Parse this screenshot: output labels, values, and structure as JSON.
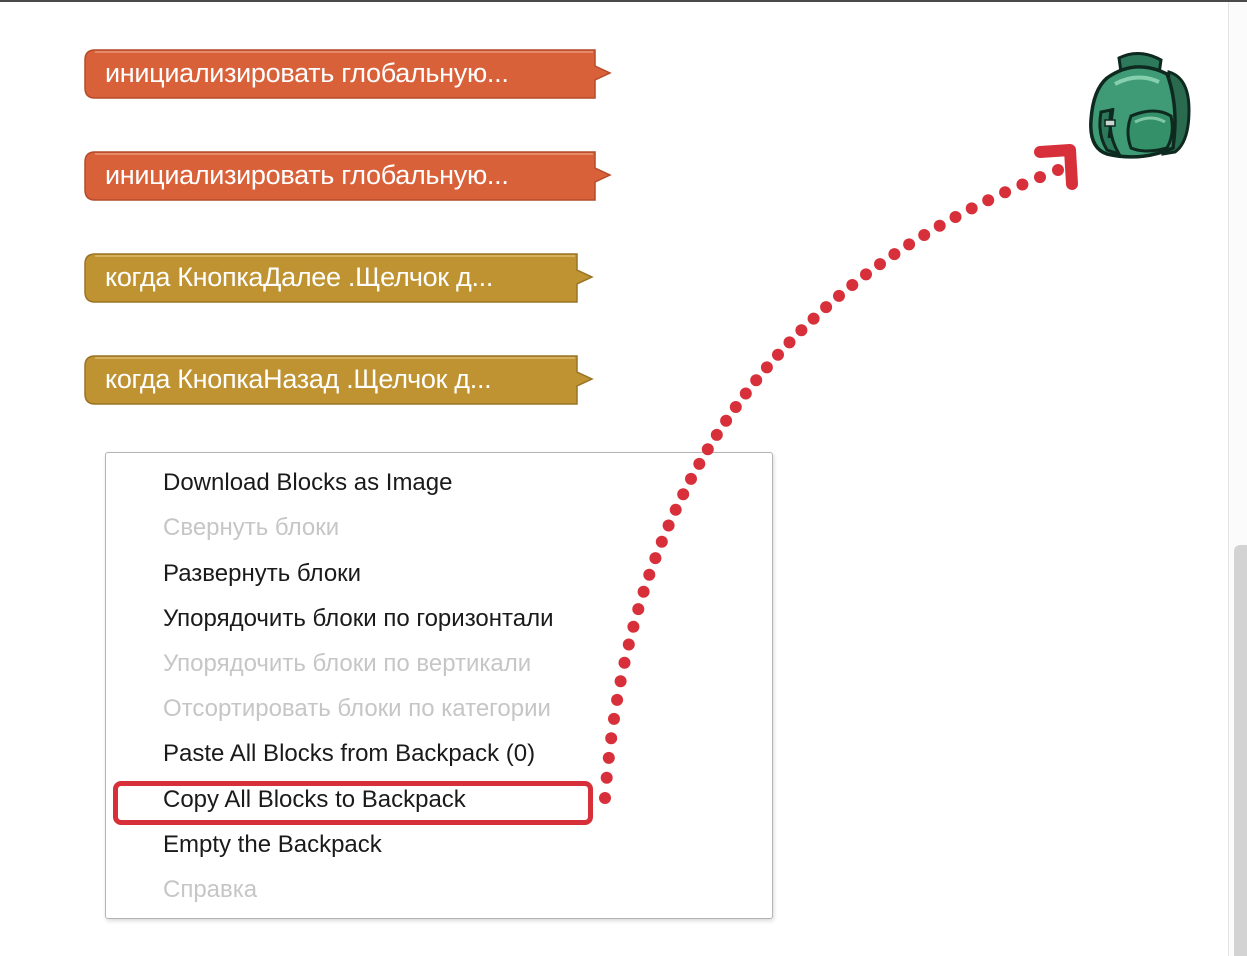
{
  "workspace": {
    "blocks": [
      {
        "label": "инициализировать глобальную...",
        "color": "#d9613a",
        "kind": "variable"
      },
      {
        "label": "инициализировать глобальную...",
        "color": "#d9613a",
        "kind": "variable"
      },
      {
        "label": "когда КнопкаДалее .Щелчок д...",
        "color": "#bf9331",
        "kind": "event"
      },
      {
        "label": "когда КнопкаНазад .Щелчок д...",
        "color": "#bf9331",
        "kind": "event"
      }
    ],
    "backpack_icon": "backpack-icon"
  },
  "context_menu": {
    "items": [
      {
        "label": "Download Blocks as Image",
        "enabled": true
      },
      {
        "label": "Свернуть блоки",
        "enabled": false
      },
      {
        "label": "Развернуть блоки",
        "enabled": true
      },
      {
        "label": "Упорядочить блоки по горизонтали",
        "enabled": true
      },
      {
        "label": "Упорядочить блоки по вертикали",
        "enabled": false
      },
      {
        "label": "Отсортировать блоки по категории",
        "enabled": false
      },
      {
        "label": "Paste All Blocks from Backpack (0)",
        "enabled": true
      },
      {
        "label": "Copy All Blocks to Backpack",
        "enabled": true,
        "highlighted": true
      },
      {
        "label": "Empty the Backpack",
        "enabled": true
      },
      {
        "label": "Справка",
        "enabled": false
      }
    ]
  },
  "annotation": {
    "highlight_color": "#d7303a",
    "arrow_color": "#d7303a"
  }
}
